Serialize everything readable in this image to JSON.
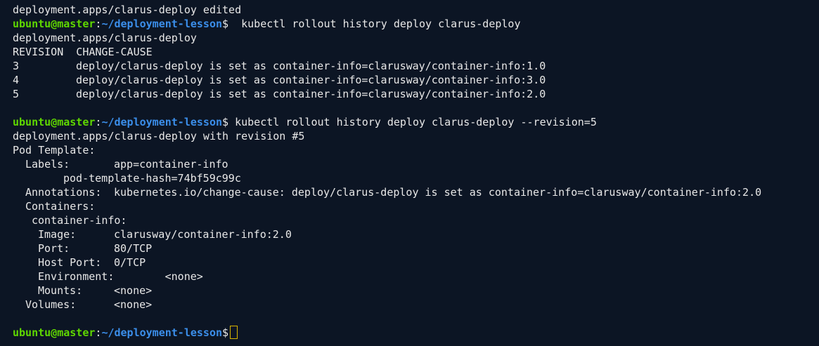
{
  "prompt": {
    "user": "ubuntu@master",
    "sep": ":",
    "path": "~/deployment-lesson",
    "dollar": "$"
  },
  "lines": {
    "l0": "deployment.apps/clarus-deploy edited",
    "cmd1": "  kubectl rollout history deploy clarus-deploy",
    "l2": "deployment.apps/clarus-deploy",
    "l3": "REVISION  CHANGE-CAUSE",
    "rev": [
      {
        "num": "3",
        "cause": "deploy/clarus-deploy is set as container-info=clarusway/container-info:1.0"
      },
      {
        "num": "4",
        "cause": "deploy/clarus-deploy is set as container-info=clarusway/container-info:3.0"
      },
      {
        "num": "5",
        "cause": "deploy/clarus-deploy is set as container-info=clarusway/container-info:2.0"
      }
    ],
    "cmd2": " kubectl rollout history deploy clarus-deploy --revision=5",
    "l9": "deployment.apps/clarus-deploy with revision #5",
    "l10": "Pod Template:",
    "labels_key": "Labels:",
    "labels_val": "app=container-info",
    "hash": "pod-template-hash=74bf59c99c",
    "annotations_key": "Annotations:",
    "annotations_val": "kubernetes.io/change-cause: deploy/clarus-deploy is set as container-info=clarusway/container-info:2.0",
    "containers": "Containers:",
    "container_name": "container-info:",
    "image_key": "Image:",
    "image_val": "clarusway/container-info:2.0",
    "port_key": "Port:",
    "port_val": "80/TCP",
    "hostport_key": "Host Port:",
    "hostport_val": "0/TCP",
    "env": "Environment:        <none>",
    "mounts_key": "Mounts:",
    "mounts_val": "<none>",
    "volumes_key": "Volumes:",
    "volumes_val": "<none>"
  },
  "colors": {
    "background": "#0c1524",
    "user": "#5fd700",
    "path": "#3b8eea",
    "text": "#e8e8e8",
    "cursor": "#d7b400"
  }
}
